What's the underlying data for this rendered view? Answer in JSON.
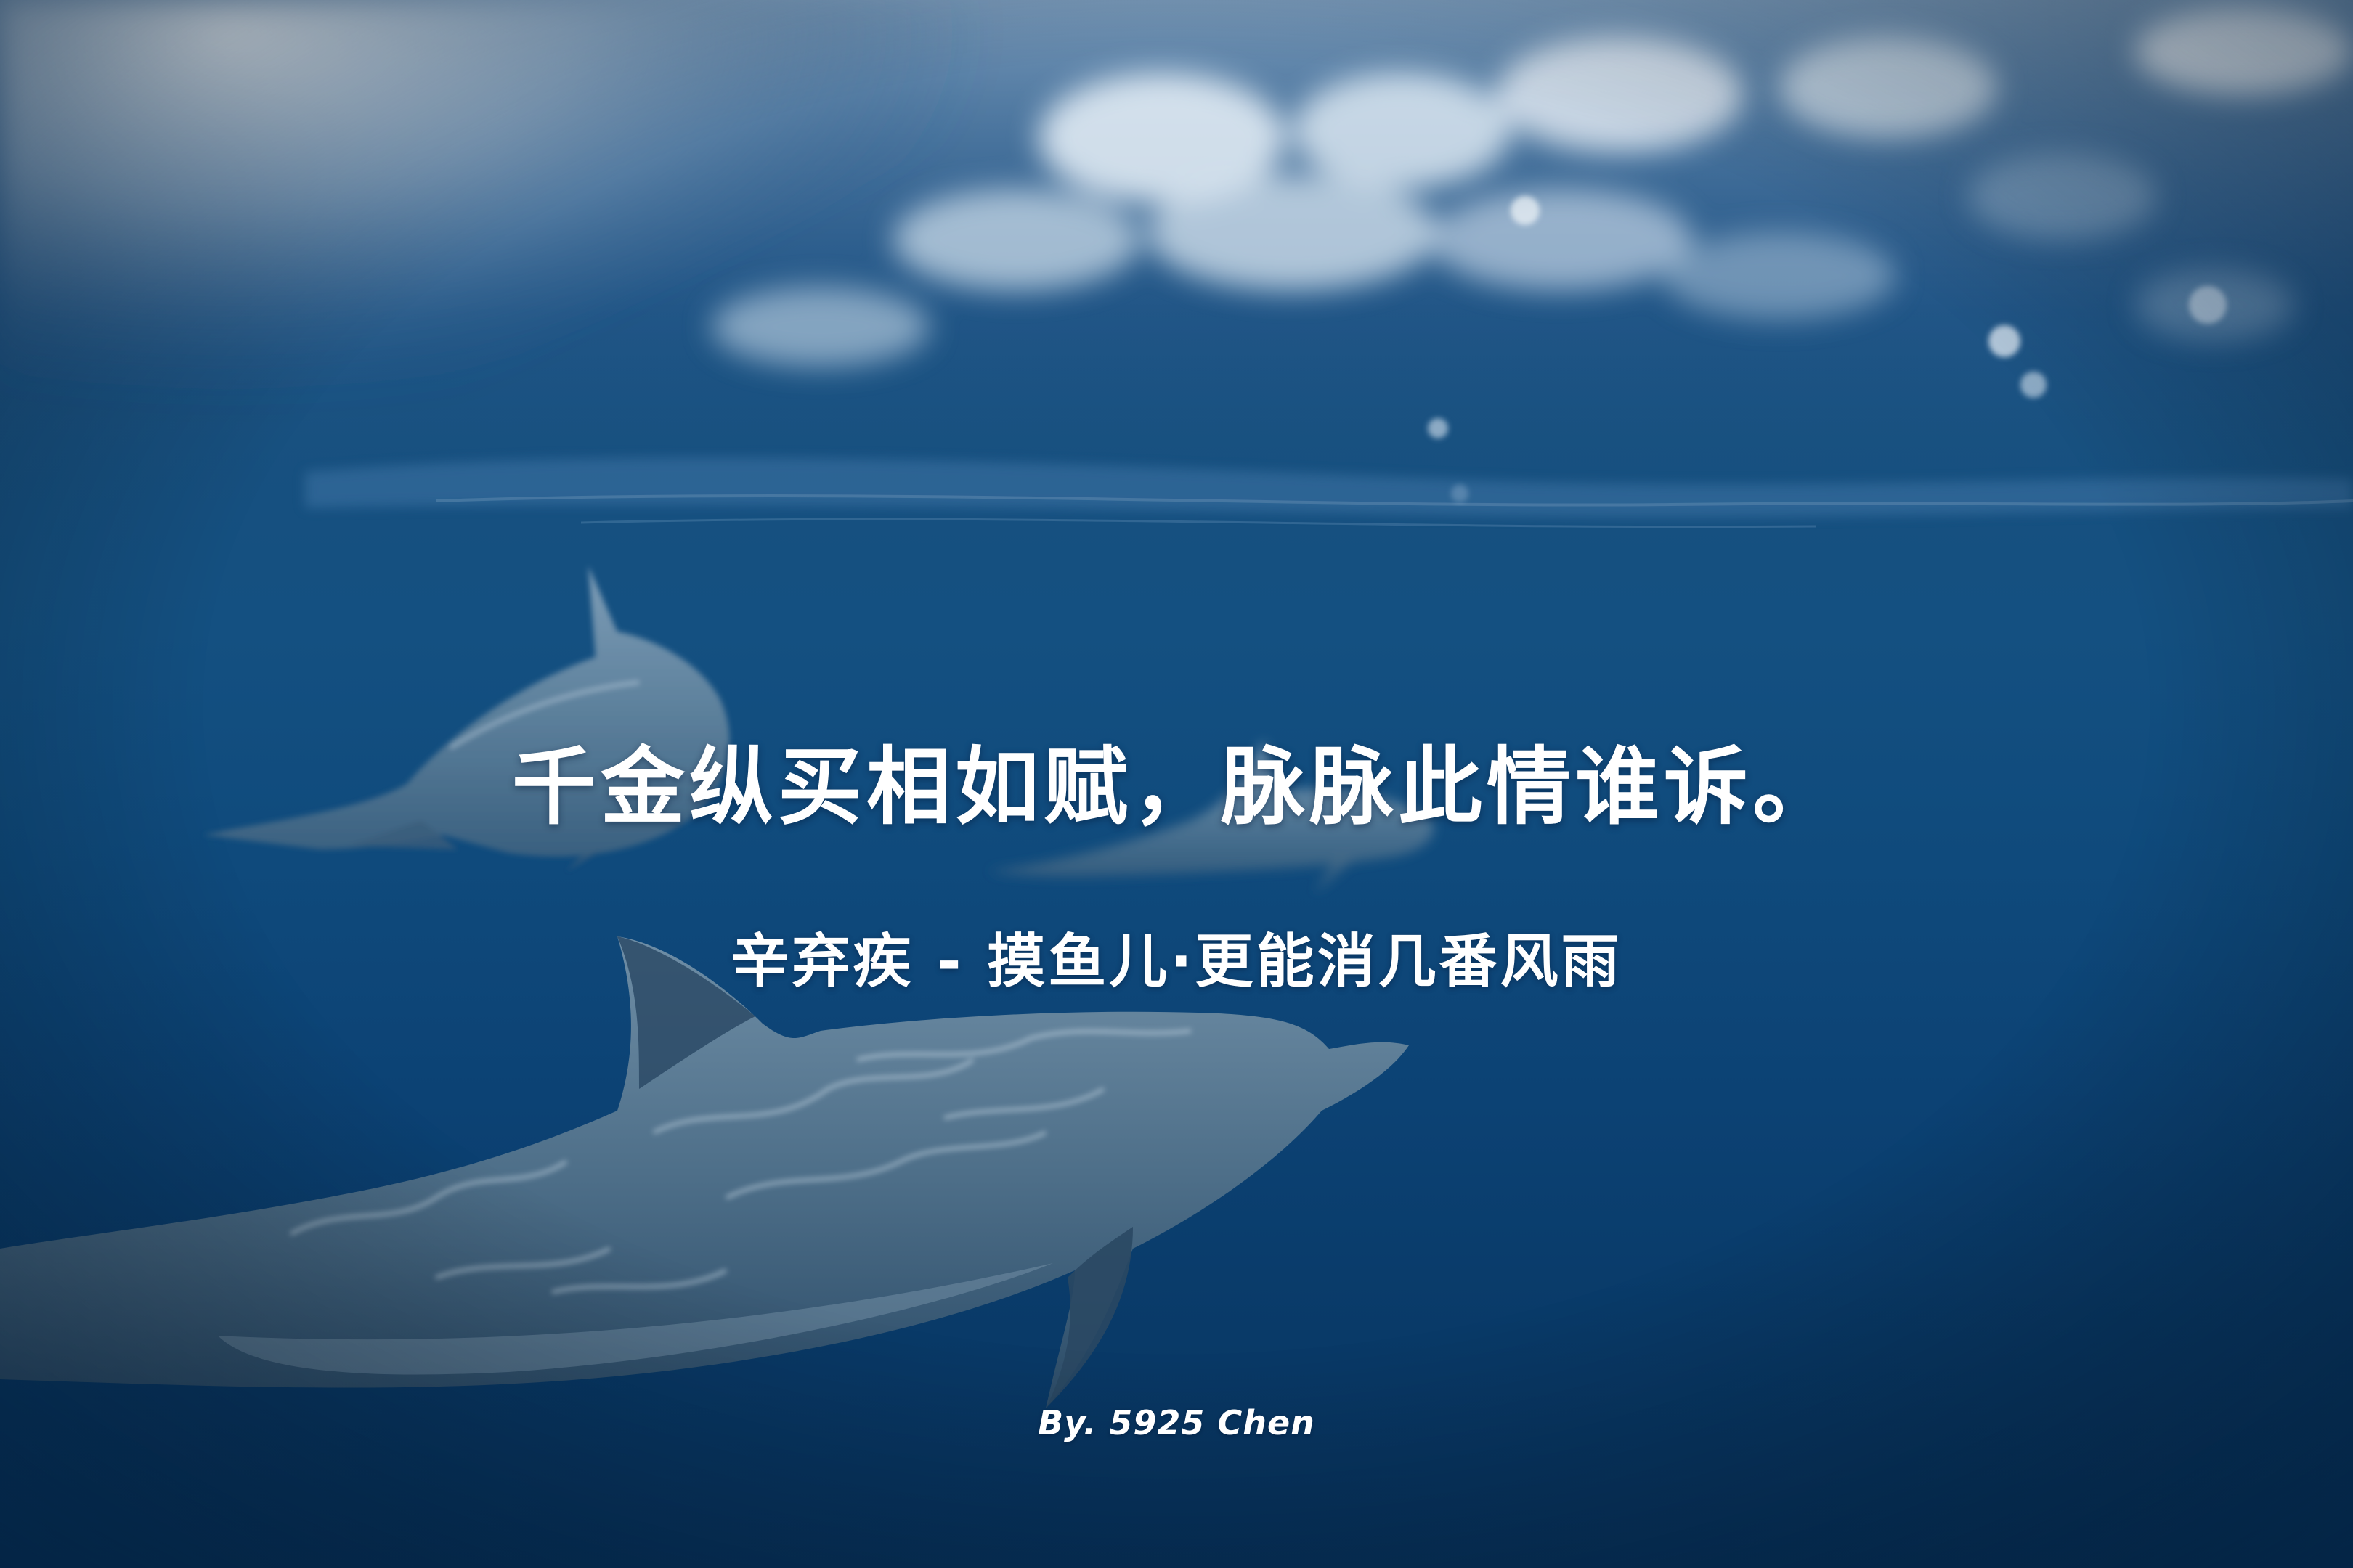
{
  "poster": {
    "quote": "千金纵买相如赋，脉脉此情谁诉。",
    "source": "辛弃疾 - 摸鱼儿·更能消几番风雨",
    "credit": "By. 5925 Chen"
  },
  "colors": {
    "ocean_deep": "#07335e",
    "ocean_mid": "#145081",
    "surface_light": "#c9d8e6",
    "dolphin_body": "#5f7e96",
    "text": "#ffffff"
  }
}
